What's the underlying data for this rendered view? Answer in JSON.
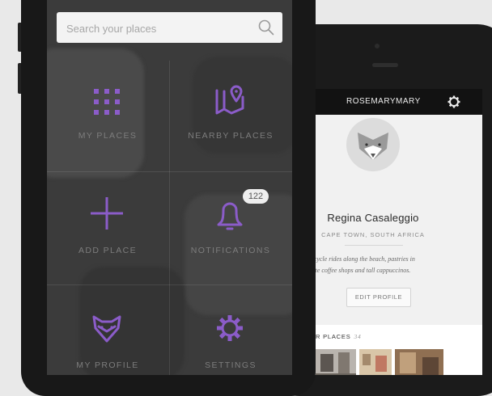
{
  "colors": {
    "accent": "#8b5cc9",
    "front_screen": "#3b3b3b",
    "bezel": "#181818"
  },
  "search": {
    "placeholder": "Search your places",
    "icon": "search-icon"
  },
  "menu": {
    "tiles": [
      {
        "label": "MY PLACES",
        "icon": "grid-icon"
      },
      {
        "label": "NEARBY PLACES",
        "icon": "map-pin-icon"
      },
      {
        "label": "ADD PLACE",
        "icon": "plus-icon"
      },
      {
        "label": "NOTIFICATIONS",
        "icon": "bell-icon",
        "badge": "122"
      },
      {
        "label": "MY PROFILE",
        "icon": "fox-icon"
      },
      {
        "label": "SETTINGS",
        "icon": "gear-icon"
      }
    ]
  },
  "profile": {
    "header_title": "ROSEMARYMARY",
    "name": "Regina Casaleggio",
    "location": "CAPE TOWN, SOUTH AFRICA",
    "bio_line1": "e bicycle rides along the beach, pastries in",
    "bio_line2": "cute coffee shops and tall cappuccinos.",
    "edit_button": "EDIT PROFILE",
    "places_label": "R PLACES",
    "places_count": "34"
  }
}
